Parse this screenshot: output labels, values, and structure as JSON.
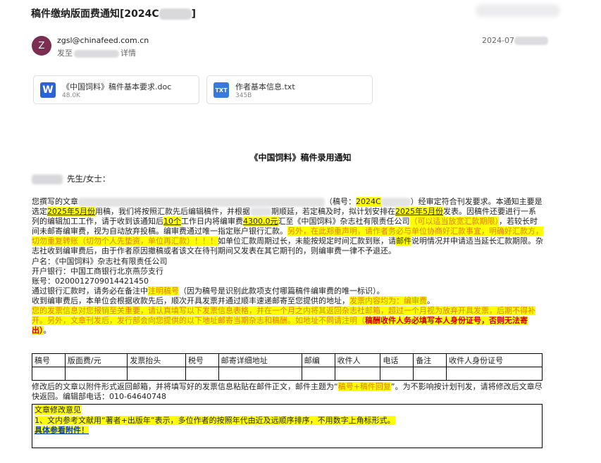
{
  "email": {
    "subject": "稿件缴纳版面费通知[2024C",
    "sender_initial": "Z",
    "sender_email": "zgsl@chinafeed.com.cn",
    "to_prefix": "发至",
    "details_link": "详情",
    "date_partial": "2024-07"
  },
  "attachments": [
    {
      "icon": "word-doc-icon",
      "icon_letter": "W",
      "name": "《中国饲料》稿件基本要求.doc",
      "size": "48.0K"
    },
    {
      "icon": "txt-file-icon",
      "icon_letter": "TXT",
      "name": "作者基本信息.txt",
      "size": "345B"
    }
  ],
  "notice": {
    "title": "《中国饲料》稿件录用通知",
    "salutation": "先生/女士：",
    "p1": {
      "a": "您撰写的文章",
      "b": "（稿号：",
      "c": "2024C",
      "d": "）经审定符合刊发要求。本通知主要是选定",
      "e": "2025年5月份",
      "f": "用稿，我们将按照汇款先后编辑稿件，并根据",
      "g": "期顺延，若定稿及时，拟计划安排在",
      "h": "2025年5月份",
      "i": "发表。因稿件还要进行一系列的编辑加工工作，请于收到该通知后",
      "j": "10个",
      "k": "工作日内将编审费",
      "l": "4300.0元",
      "m": "汇至《中国饲料》杂志社有限责任公司",
      "n": "（可以适当放宽汇款期限）",
      "o": "，若较长时间未邮寄编审费，视为自动放弃投稿。编审费通过唯一指定账户银行汇款。",
      "p": "另外，在此郑重声明，请作者务必与单位协商好汇款事宜，明确好汇款方，切勿重复转账（切勿个人先垫资，单位再汇款）！！！",
      "q": "如单位汇款周期过长，未能按规定时间汇款到账，请",
      "r": "邮件",
      "s": "说明情况并申请适当延长汇款期限。杂志社收到编审费后，由于作者原因撤稿或者该文在待刊期间又发表在其它期刊的，则编审费一律不予退还。"
    },
    "account_name": "户名：《中国饲料》杂志社有限责任公司",
    "bank": "开户银行：中国工商银行北京燕莎支行",
    "account_no": "账号：0200012709014421450",
    "remark": {
      "a": "通过银行汇款时，请务必在备注中",
      "b": "注明稿号",
      "c": "（因为稿号是识别此款项支付哪篇稿件编审费的唯一标识）。"
    },
    "invoice": {
      "a": "收到编审费后，本单位会根据收款先后，顺次开具发票并通过顺丰速递邮寄至您提供的地址，",
      "b": "发票内容均为：编审费",
      "c": "。",
      "d": "您的发票信息对您报销至关重要，请认真填写以下发票信息表格，并在一个月之内将其返回杂志社邮箱，超过一个月视为放弃开具发票，后期不得补开。另外，文章刊发后，发行部会向您提供的以下地址邮寄当期杂志和稿酬。如地址不同请注明（",
      "e": "稿酬收件人务必填写本人身份证号，否则无法寄出）",
      "f": "。"
    },
    "table_headers": [
      "稿号",
      "版面费/元",
      "发票抬头",
      "税号",
      "邮寄详细地址",
      "邮编",
      "收件人",
      "电话",
      "备注",
      "收件人身份证号"
    ],
    "closing": {
      "a": "修改后的文章以附件形式返回邮箱，并将填写好的发票信息粘贴在邮件正文，邮件主题为“",
      "b": "稿号+稿件回复",
      "c": "”。为不影响按计划刊发，请将修改后文章尽快返回。编辑部电话：010-64640748"
    },
    "revision": {
      "title": "文章修改意见",
      "item1": "1、文内参考文献用“著者+出版年”表示，多位作者的按照年代由近及远顺序排序，不用数字上角标形式。",
      "see_attachment": "具体参看附件！"
    }
  },
  "colors": {
    "highlight": "#ffff00",
    "red_text": "#d00000",
    "orange_text": "#e08000",
    "avatar_bg": "#7b2d52",
    "word_icon": "#2b63d6",
    "txt_icon": "#3979db"
  }
}
